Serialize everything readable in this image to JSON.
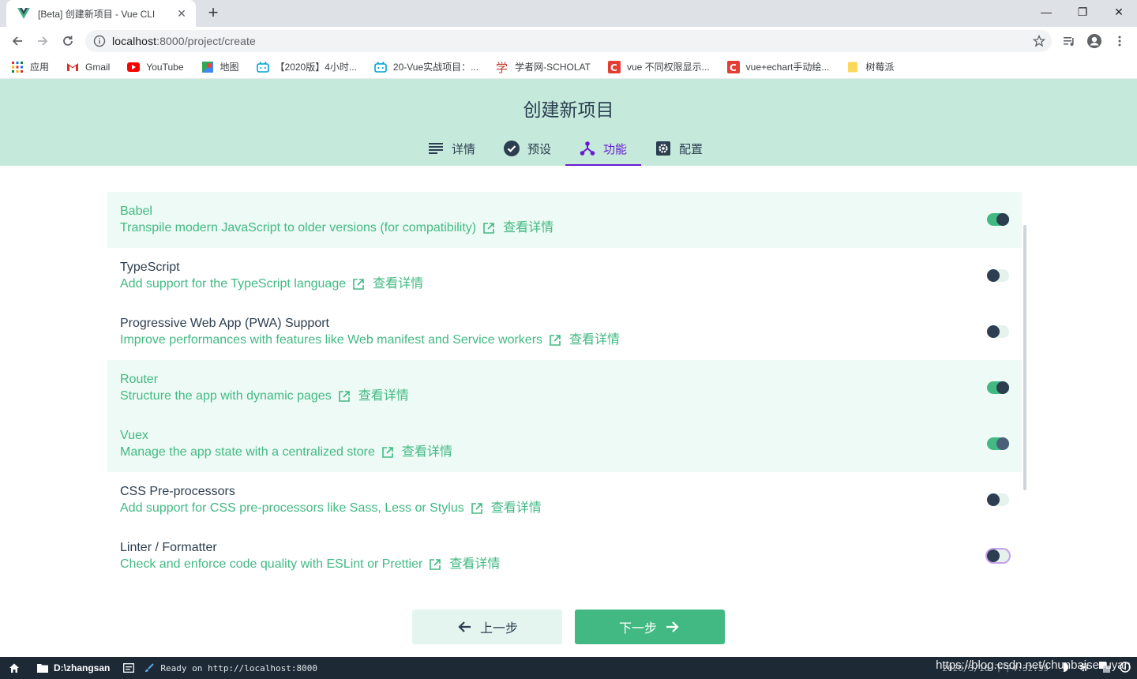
{
  "browser": {
    "tab_title": "[Beta] 创建新项目 - Vue CLI",
    "url_host": "localhost",
    "url_rest": ":8000/project/create"
  },
  "bookmarks": [
    {
      "label": "应用",
      "icon": "apps-grid-icon"
    },
    {
      "label": "Gmail",
      "icon": "gmail-icon"
    },
    {
      "label": "YouTube",
      "icon": "youtube-icon"
    },
    {
      "label": "地图",
      "icon": "maps-icon"
    },
    {
      "label": "【2020版】4小时...",
      "icon": "bilibili-icon"
    },
    {
      "label": "20-Vue实战项目：...",
      "icon": "bilibili-icon"
    },
    {
      "label": "学者网-SCHOLAT",
      "icon": "scholat-icon"
    },
    {
      "label": "vue 不同权限显示...",
      "icon": "csdn-icon"
    },
    {
      "label": "vue+echart手动绘...",
      "icon": "csdn-icon"
    },
    {
      "label": "树莓派",
      "icon": "folder-icon"
    }
  ],
  "page": {
    "title": "创建新项目",
    "steps": [
      {
        "label": "详情",
        "icon": "details-list-icon",
        "active": false
      },
      {
        "label": "预设",
        "icon": "check-circle-icon",
        "active": false
      },
      {
        "label": "功能",
        "icon": "branch-icon",
        "active": true
      },
      {
        "label": "配置",
        "icon": "settings-icon",
        "active": false
      }
    ]
  },
  "features": [
    {
      "name": "Babel",
      "desc": "Transpile modern JavaScript to older versions (for compatibility)",
      "link": "查看详情",
      "enabled": true
    },
    {
      "name": "TypeScript",
      "desc": "Add support for the TypeScript language",
      "link": "查看详情",
      "enabled": false
    },
    {
      "name": "Progressive Web App (PWA) Support",
      "desc": "Improve performances with features like Web manifest and Service workers",
      "link": "查看详情",
      "enabled": false
    },
    {
      "name": "Router",
      "desc": "Structure the app with dynamic pages",
      "link": "查看详情",
      "enabled": true
    },
    {
      "name": "Vuex",
      "desc": "Manage the app state with a centralized store",
      "link": "查看详情",
      "enabled": true
    },
    {
      "name": "CSS Pre-processors",
      "desc": "Add support for CSS pre-processors like Sass, Less or Stylus",
      "link": "查看详情",
      "enabled": false
    },
    {
      "name": "Linter / Formatter",
      "desc": "Check and enforce code quality with ESLint or Prettier",
      "link": "查看详情",
      "enabled": false
    }
  ],
  "buttons": {
    "prev": "上一步",
    "next": "下一步"
  },
  "statusbar": {
    "folder": "D:\\zhangsan",
    "status": "Ready on http://localhost:8000",
    "time": "2020/3/16 下午4:32:39"
  },
  "watermark": "https://blog.csdn.net/chunbaisesuyan",
  "colors": {
    "accent_green": "#42b983",
    "header_bg": "#c5eadc",
    "active_step": "#6a1bd1",
    "dark": "#2c3e50"
  }
}
